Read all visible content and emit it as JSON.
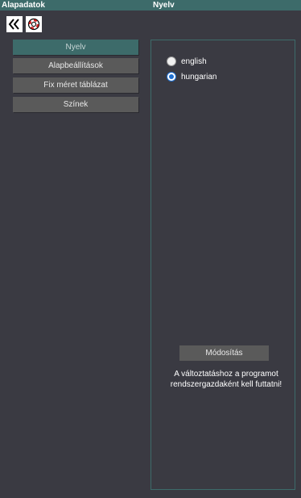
{
  "titlebar": {
    "left_title": "Alapadatok",
    "center_title": "Nyelv"
  },
  "toolbar": {
    "back_icon": "double-chevron-left-icon",
    "help_icon": "lifebuoy-icon"
  },
  "sidebar": {
    "items": [
      {
        "label": "Nyelv",
        "active": true
      },
      {
        "label": "Alapbeállítások",
        "active": false
      },
      {
        "label": "Fix méret táblázat",
        "active": false
      },
      {
        "label": "Színek",
        "active": false
      }
    ]
  },
  "language": {
    "options": [
      {
        "label": "english",
        "checked": false
      },
      {
        "label": "hungarian",
        "checked": true
      }
    ],
    "modify_label": "Módosítás",
    "note": "A változtatáshoz a programot rendszergazdaként kell futtatni!"
  },
  "colors": {
    "background": "#3a3a42",
    "accent": "#3d6b6a",
    "button": "#5a5a5a",
    "radio_selected": "#1e6fd0"
  }
}
